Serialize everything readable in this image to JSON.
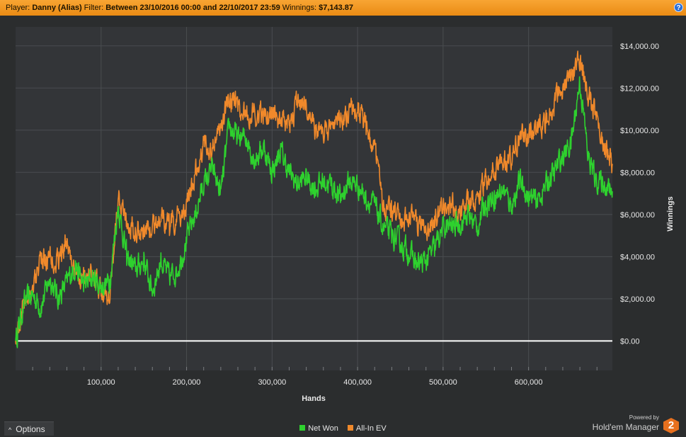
{
  "header": {
    "player_label": "Player:",
    "player_value": "Danny (Alias)",
    "filter_label": "Filter:",
    "filter_value": "Between 23/10/2016 00:00 and 22/10/2017 23:59",
    "winnings_label": "Winnings:",
    "winnings_value": "$7,143.87",
    "help_symbol": "?"
  },
  "options": {
    "label": "Options",
    "chevron": "^"
  },
  "legend": {
    "net_won": "Net Won",
    "all_in_ev": "All-In EV"
  },
  "brand": {
    "powered_by": "Powered by",
    "name": "Hold'em Manager",
    "logo_text": "2"
  },
  "colors": {
    "net_won": "#2ed12e",
    "all_in_ev": "#f0892b",
    "zero_line": "#ffffff",
    "plot_bg": "#333538",
    "grid": "#4a4d50",
    "axis_text": "#e8e8e8"
  },
  "chart_data": {
    "type": "line",
    "xlabel": "Hands",
    "ylabel": "Winnings",
    "xlim": [
      0,
      698000
    ],
    "ylim": [
      -1400,
      14900
    ],
    "x_ticks": [
      100000,
      200000,
      300000,
      400000,
      500000,
      600000
    ],
    "x_tick_labels": [
      "100,000",
      "200,000",
      "300,000",
      "400,000",
      "500,000",
      "600,000"
    ],
    "y_ticks": [
      0,
      2000,
      4000,
      6000,
      8000,
      10000,
      12000,
      14000
    ],
    "y_tick_labels": [
      "$0.00",
      "$2,000.00",
      "$4,000.00",
      "$6,000.00",
      "$8,000.00",
      "$10,000.00",
      "$12,000.00",
      "$14,000.00"
    ],
    "grid": true,
    "legend_position": "bottom-center",
    "series": [
      {
        "name": "Net Won",
        "x": [
          0,
          10000,
          20000,
          30000,
          40000,
          50000,
          60000,
          70000,
          80000,
          90000,
          100000,
          110000,
          120000,
          130000,
          140000,
          150000,
          160000,
          170000,
          180000,
          190000,
          200000,
          210000,
          220000,
          230000,
          240000,
          250000,
          260000,
          270000,
          280000,
          290000,
          300000,
          310000,
          320000,
          330000,
          340000,
          350000,
          360000,
          370000,
          380000,
          390000,
          400000,
          410000,
          420000,
          430000,
          440000,
          450000,
          460000,
          470000,
          480000,
          490000,
          500000,
          510000,
          520000,
          530000,
          540000,
          550000,
          560000,
          570000,
          580000,
          590000,
          600000,
          610000,
          620000,
          630000,
          640000,
          650000,
          660000,
          670000,
          680000,
          690000,
          698000
        ],
        "y": [
          0,
          1800,
          2200,
          1600,
          3000,
          2000,
          2800,
          3600,
          2600,
          3000,
          2600,
          2800,
          6400,
          4000,
          3400,
          3800,
          2400,
          3800,
          3000,
          3400,
          4800,
          6000,
          7400,
          8200,
          7000,
          10200,
          9600,
          9600,
          8600,
          9200,
          8000,
          9000,
          8000,
          7400,
          7800,
          7200,
          7600,
          7400,
          6800,
          7600,
          7400,
          6800,
          6400,
          5400,
          5000,
          4600,
          4200,
          3600,
          3800,
          4400,
          5400,
          5400,
          5600,
          6000,
          5400,
          6600,
          6800,
          7200,
          6400,
          7600,
          6800,
          6600,
          7400,
          8000,
          8800,
          9400,
          12400,
          8600,
          7600,
          7400,
          7100
        ]
      },
      {
        "name": "All-In EV",
        "x": [
          0,
          10000,
          20000,
          30000,
          40000,
          50000,
          60000,
          70000,
          80000,
          90000,
          100000,
          110000,
          120000,
          130000,
          140000,
          150000,
          160000,
          170000,
          180000,
          190000,
          200000,
          210000,
          220000,
          230000,
          240000,
          250000,
          260000,
          270000,
          280000,
          290000,
          300000,
          310000,
          320000,
          330000,
          340000,
          350000,
          360000,
          370000,
          380000,
          390000,
          400000,
          410000,
          420000,
          430000,
          440000,
          450000,
          460000,
          470000,
          480000,
          490000,
          500000,
          510000,
          520000,
          530000,
          540000,
          550000,
          560000,
          570000,
          580000,
          590000,
          600000,
          610000,
          620000,
          630000,
          640000,
          650000,
          660000,
          670000,
          680000,
          690000,
          698000
        ],
        "y": [
          0,
          1900,
          2600,
          3800,
          4000,
          3800,
          4800,
          3000,
          3200,
          3000,
          2400,
          2200,
          7000,
          5600,
          5400,
          5200,
          5400,
          6000,
          5400,
          5800,
          6400,
          7800,
          9400,
          9000,
          10200,
          11600,
          11000,
          10800,
          10800,
          10600,
          10900,
          10400,
          10000,
          11400,
          11200,
          10000,
          9800,
          10400,
          10600,
          10900,
          11000,
          10200,
          9200,
          6400,
          6200,
          5600,
          6000,
          5600,
          5200,
          5600,
          6400,
          6400,
          6200,
          6600,
          6800,
          7600,
          8200,
          8400,
          8800,
          9600,
          9800,
          10000,
          10400,
          11200,
          12000,
          12600,
          13200,
          11600,
          10400,
          9000,
          8400
        ]
      }
    ]
  }
}
